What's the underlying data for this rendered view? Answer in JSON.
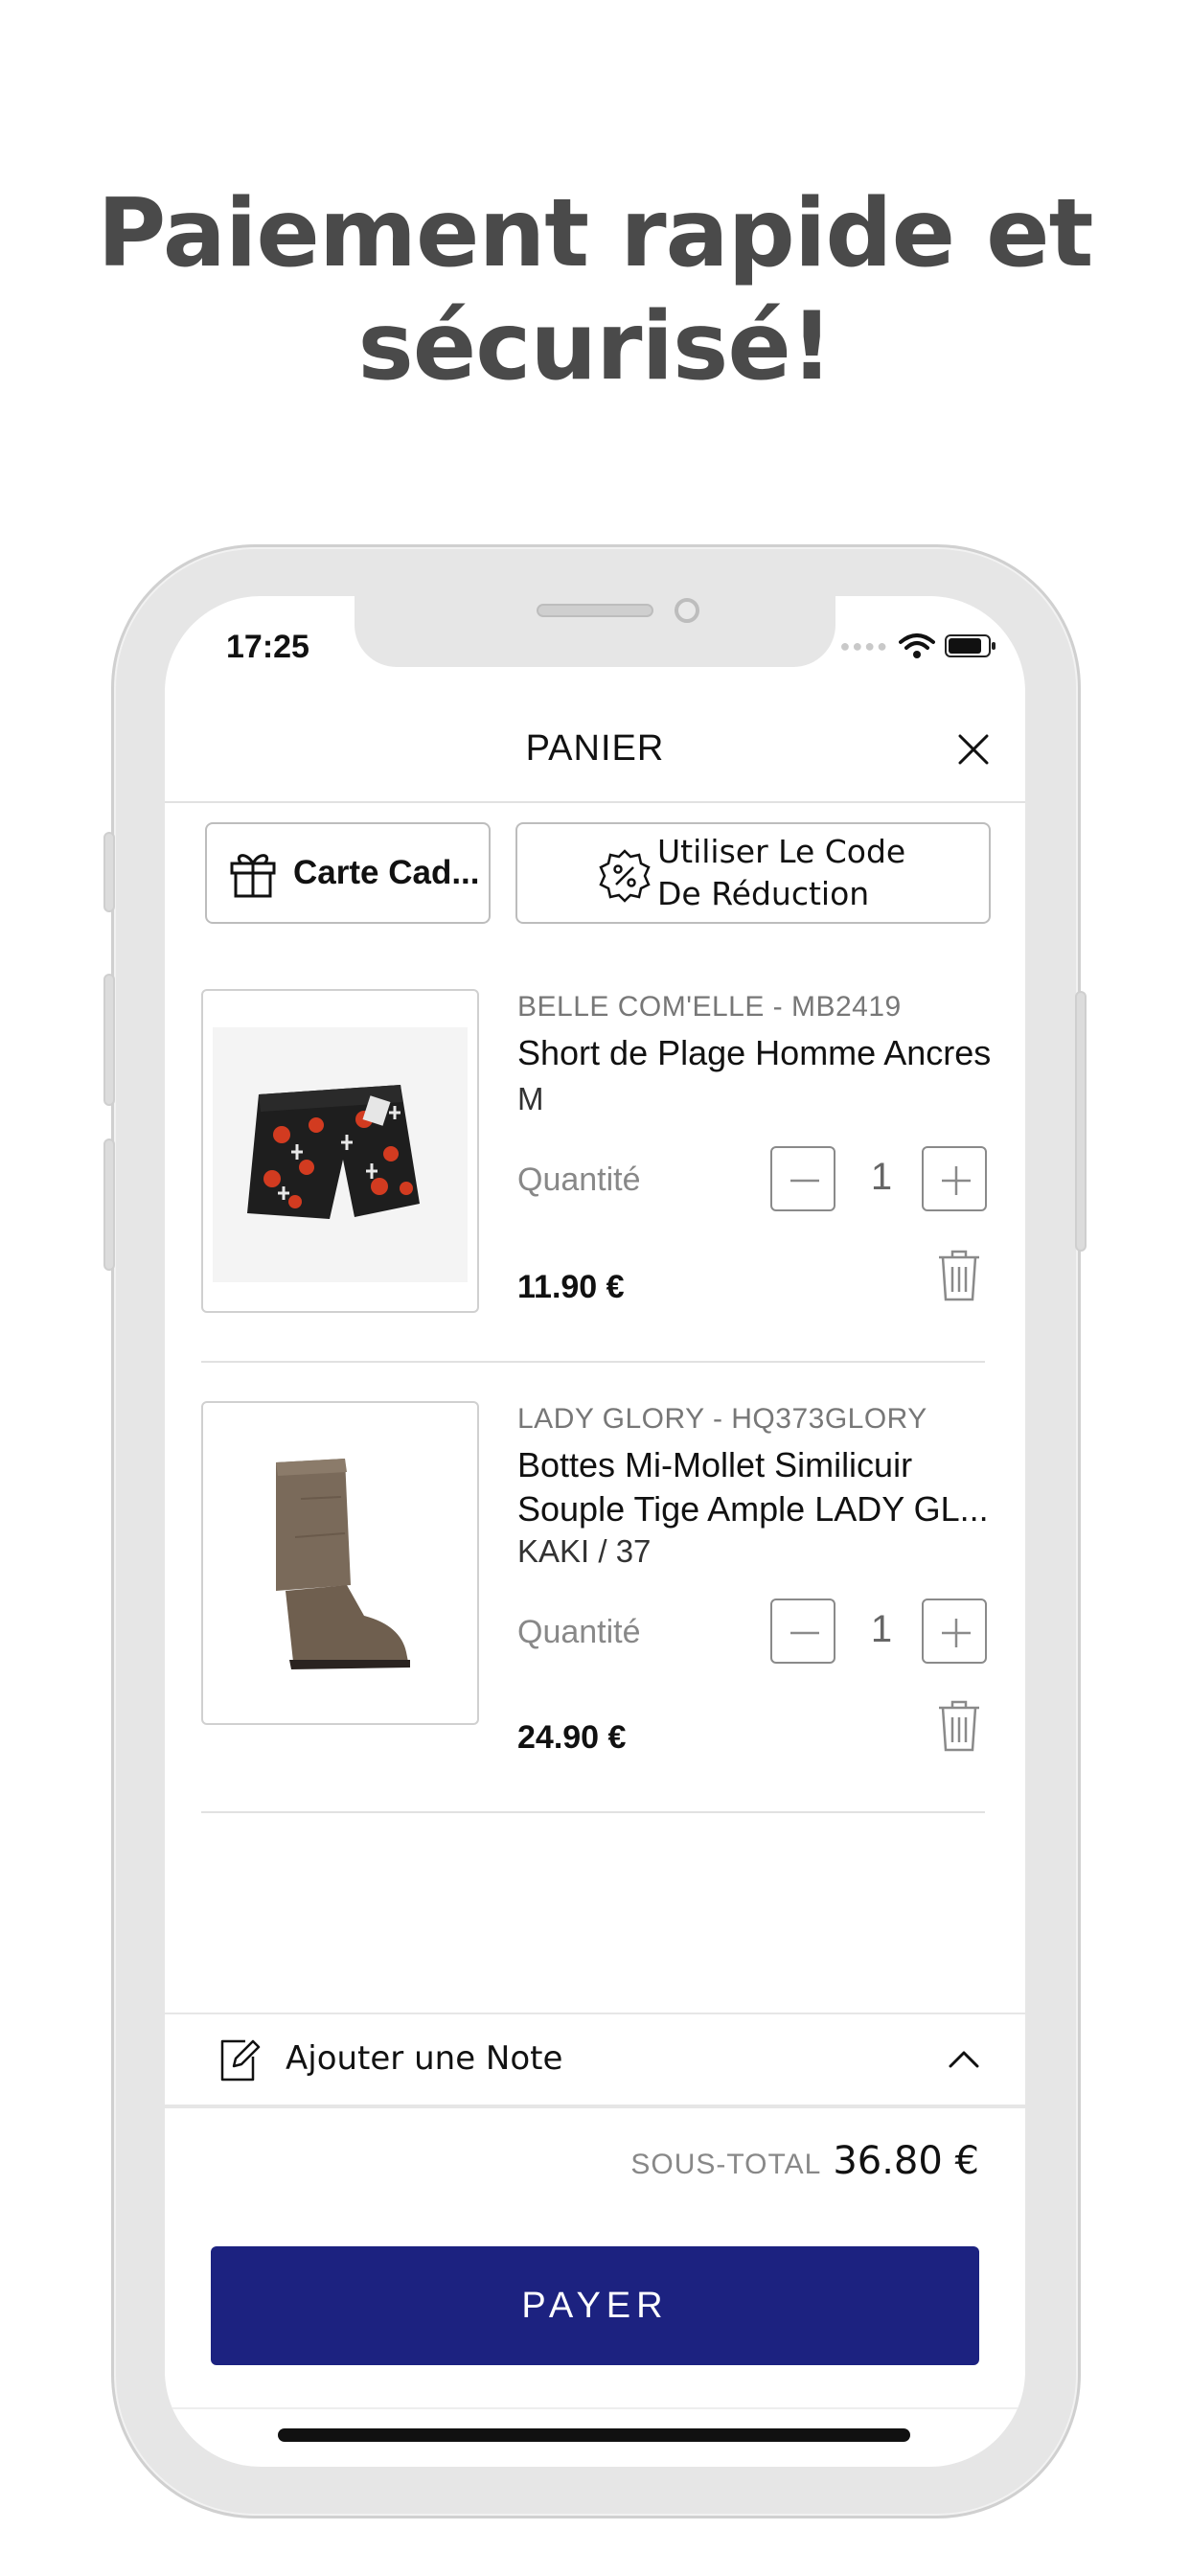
{
  "headline": {
    "line1": "Paiement rapide et",
    "line2": "sécurisé!"
  },
  "status_bar": {
    "time": "17:25"
  },
  "nav": {
    "title": "PANIER"
  },
  "actions": {
    "gift_card_label": "Carte Cad...",
    "discount_label_line1": "Utiliser Le Code",
    "discount_label_line2": "De Réduction"
  },
  "cart": {
    "quantity_label": "Quantité",
    "items": [
      {
        "brand": "BELLE COM'ELLE - MB2419",
        "name_line1": "Short de Plage Homme Ancres",
        "name_line2": "",
        "variant": "M",
        "quantity": "1",
        "price": "11.90 €"
      },
      {
        "brand": "LADY GLORY - HQ373GLORY",
        "name_line1": "Bottes Mi-Mollet Similicuir",
        "name_line2": "Souple Tige Ample  LADY GL...",
        "variant": "KAKI / 37",
        "quantity": "1",
        "price": "24.90 €"
      }
    ]
  },
  "note": {
    "label": "Ajouter une Note"
  },
  "summary": {
    "subtotal_label": "SOUS-TOTAL",
    "subtotal_value": "36.80 €"
  },
  "checkout": {
    "pay_label": "PAYER"
  },
  "colors": {
    "accent": "#1c2280",
    "headline": "#4a4a4a"
  }
}
